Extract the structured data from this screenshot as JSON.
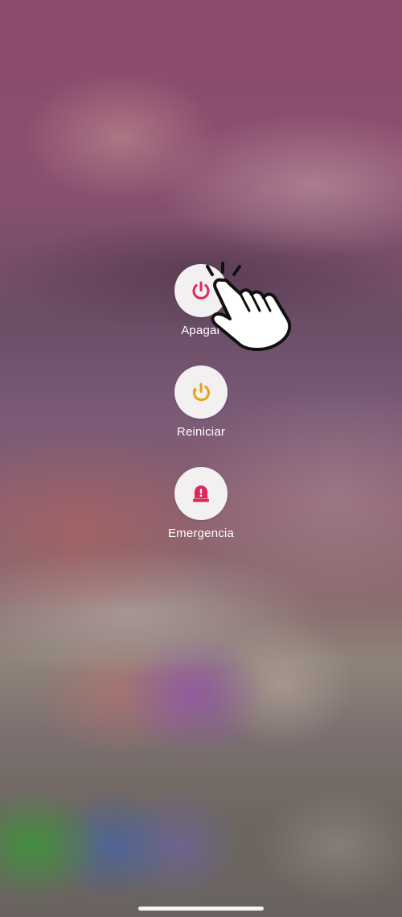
{
  "power_menu": {
    "options": [
      {
        "label": "Apagar",
        "icon": "power-icon",
        "color": "#e0265a"
      },
      {
        "label": "Reiniciar",
        "icon": "restart-icon",
        "color": "#e8a118"
      },
      {
        "label": "Emergencia",
        "icon": "emergency-siren-icon",
        "color": "#e0265a"
      }
    ]
  },
  "overlay": {
    "icon": "tap-hand-icon"
  }
}
